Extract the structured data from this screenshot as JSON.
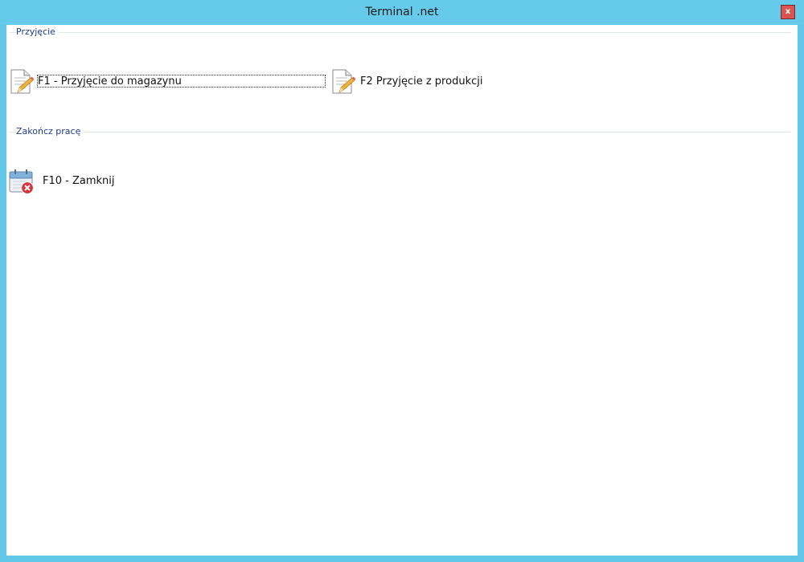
{
  "window": {
    "title": "Terminal .net",
    "close_label": "x"
  },
  "groups": [
    {
      "label": "Przyjęcie",
      "items": [
        {
          "label": "F1 - Przyjęcie do magazynu",
          "icon": "document-edit-icon",
          "focused": true
        },
        {
          "label": "F2 Przyjęcie z produkcji",
          "icon": "document-edit-icon",
          "focused": false
        }
      ]
    },
    {
      "label": "Zakończ pracę",
      "items": [
        {
          "label": "F10 - Zamknij",
          "icon": "calendar-close-icon",
          "focused": false
        }
      ]
    }
  ],
  "colors": {
    "titlebar": "#66cbea",
    "group_label": "#1e3d8f",
    "close_button": "#d9534f"
  }
}
